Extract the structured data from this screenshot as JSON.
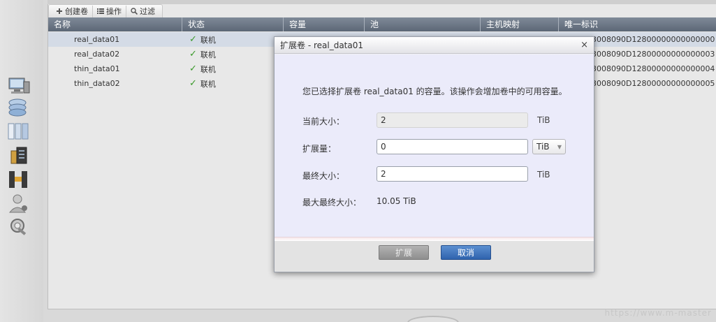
{
  "toolbar": {
    "create_label": "创建卷",
    "actions_label": "操作",
    "filter_label": "过滤"
  },
  "table": {
    "headers": [
      "名称",
      "状态",
      "容量",
      "池",
      "主机映射",
      "唯一标识"
    ],
    "rows": [
      {
        "name": "real_data01",
        "status": "联机",
        "id": "3008090D12800000000000000",
        "selected": true
      },
      {
        "name": "real_data02",
        "status": "联机",
        "id": "3008090D12800000000000003",
        "selected": false
      },
      {
        "name": "thin_data01",
        "status": "联机",
        "id": "3008090D12800000000000004",
        "selected": false
      },
      {
        "name": "thin_data02",
        "status": "联机",
        "id": "3008090D12800000000000005",
        "selected": false
      }
    ]
  },
  "dialog": {
    "title": "扩展卷 - real_data01",
    "close_label": "×",
    "message": "您已选择扩展卷 real_data01 的容量。该操作会增加卷中的可用容量。",
    "current_size_label": "当前大小：",
    "current_size_value": "2",
    "current_size_unit": "TiB",
    "expand_by_label": "扩展量：",
    "expand_by_value": "0",
    "expand_by_unit": "TiB",
    "final_size_label": "最终大小：",
    "final_size_value": "2",
    "final_size_unit": "TiB",
    "max_final_size_label": "最大最终大小：",
    "max_final_size_value": "10.05 TiB",
    "expand_button": "扩展",
    "cancel_button": "取消"
  },
  "watermark": "https://www.m-master"
}
